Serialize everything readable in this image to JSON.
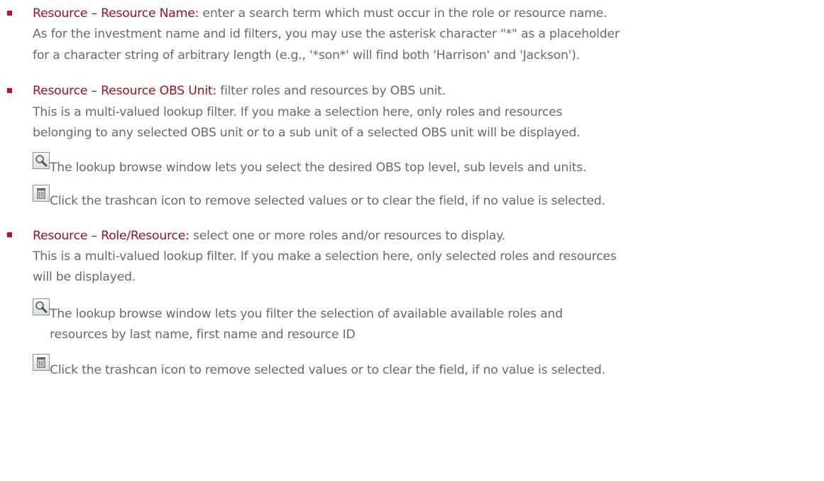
{
  "icons": {
    "lookup": "magnifier-icon",
    "trash": "trashcan-icon"
  },
  "items": [
    {
      "term": "Resource – Resource Name:",
      "lines": [
        " enter a search term which must occur in the role or resource name.",
        "As for the investment name and id filters, you may use the asterisk character \"*\" as a placeholder",
        "for a character string of arbitrary length (e.g., '*son*' will find both 'Harrison' and 'Jackson')."
      ]
    },
    {
      "term": "Resource – Resource OBS Unit:",
      "lines": [
        " filter roles and resources by OBS unit.",
        "This is a multi-valued lookup filter. If you make a selection here, only roles and resources",
        "belonging to any selected OBS unit or to a sub unit of a selected OBS unit will be displayed."
      ],
      "lookup_text": "The lookup browse window lets you select the desired OBS top level, sub levels and units.",
      "trash_text": "Click the trashcan icon to remove selected values or to clear the field, if no value is selected."
    },
    {
      "term": "Resource – Role/Resource:",
      "lines": [
        " select one or more roles and/or resources to display.",
        "This is a multi-valued lookup filter. If you make a selection here, only selected roles and resources",
        "will be displayed."
      ],
      "lookup_text": "The lookup browse window lets you filter the selection of available available roles and",
      "lookup_text_cont": "resources by last name, first name and resource ID",
      "trash_text": "Click the trashcan icon to remove selected values or to clear the field, if no value is selected."
    }
  ]
}
